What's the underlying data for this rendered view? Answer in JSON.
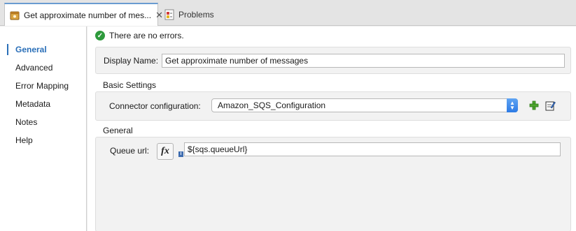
{
  "tabs": [
    {
      "label": "Get approximate number of mes...",
      "close": "✕",
      "icon": "mule-component-icon"
    },
    {
      "label": "Problems",
      "icon": "problems-icon"
    }
  ],
  "sidebar": {
    "items": [
      {
        "label": "General",
        "selected": true
      },
      {
        "label": "Advanced"
      },
      {
        "label": "Error Mapping"
      },
      {
        "label": "Metadata"
      },
      {
        "label": "Notes"
      },
      {
        "label": "Help"
      }
    ]
  },
  "status": {
    "text": "There are no errors.",
    "icon": "check-circle-icon",
    "color": "#2e9a3c"
  },
  "display_name": {
    "label": "Display Name:",
    "value": "Get approximate number of messages"
  },
  "basic_settings": {
    "title": "Basic Settings",
    "connector_label": "Connector configuration:",
    "connector_value": "Amazon_SQS_Configuration"
  },
  "general": {
    "title": "General",
    "queue_label": "Queue url:",
    "fx_label": "fx",
    "queue_value": "${sqs.queueUrl}"
  },
  "colors": {
    "accent": "#2a6fb8",
    "select_arrow": "#2d7be5"
  }
}
